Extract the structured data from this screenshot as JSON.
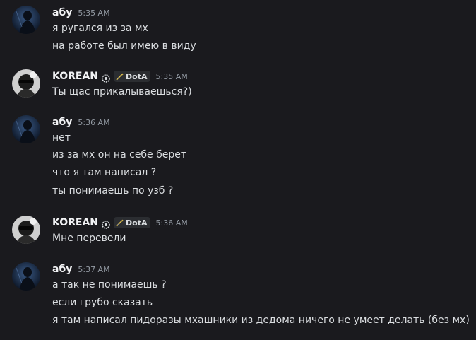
{
  "messages": [
    {
      "author": "абу",
      "time": "5:35 AM",
      "lines": [
        "я ругался из за мх",
        "на работе был имею в виду"
      ]
    },
    {
      "author": "KOREAN",
      "badge_icon": "gear-badge-icon",
      "tag": "DotA",
      "tag_icon": "swords-icon",
      "time": "5:35 AM",
      "lines": [
        "Ты щас прикалываешься?)"
      ]
    },
    {
      "author": "абу",
      "time": "5:36 AM",
      "lines": [
        "нет",
        "из за мх он на себе берет",
        "что я там написал ?",
        "ты понимаешь по узб ?"
      ]
    },
    {
      "author": "KOREAN",
      "badge_icon": "gear-badge-icon",
      "tag": "DotA",
      "tag_icon": "swords-icon",
      "time": "5:36 AM",
      "lines": [
        "Мне перевели"
      ]
    },
    {
      "author": "абу",
      "time": "5:37 AM",
      "lines": [
        "а так не понимаешь ?",
        "если грубо сказать",
        "я там написал пидоразы мхашники из дедома ничего не умеет делать (без мх)"
      ]
    }
  ],
  "colors": {
    "background": "#1a1a1e",
    "username": "#f2f3f5",
    "timestamp": "#949ba4",
    "message_text": "#dbdee1",
    "tag_background": "#2b2d31"
  }
}
